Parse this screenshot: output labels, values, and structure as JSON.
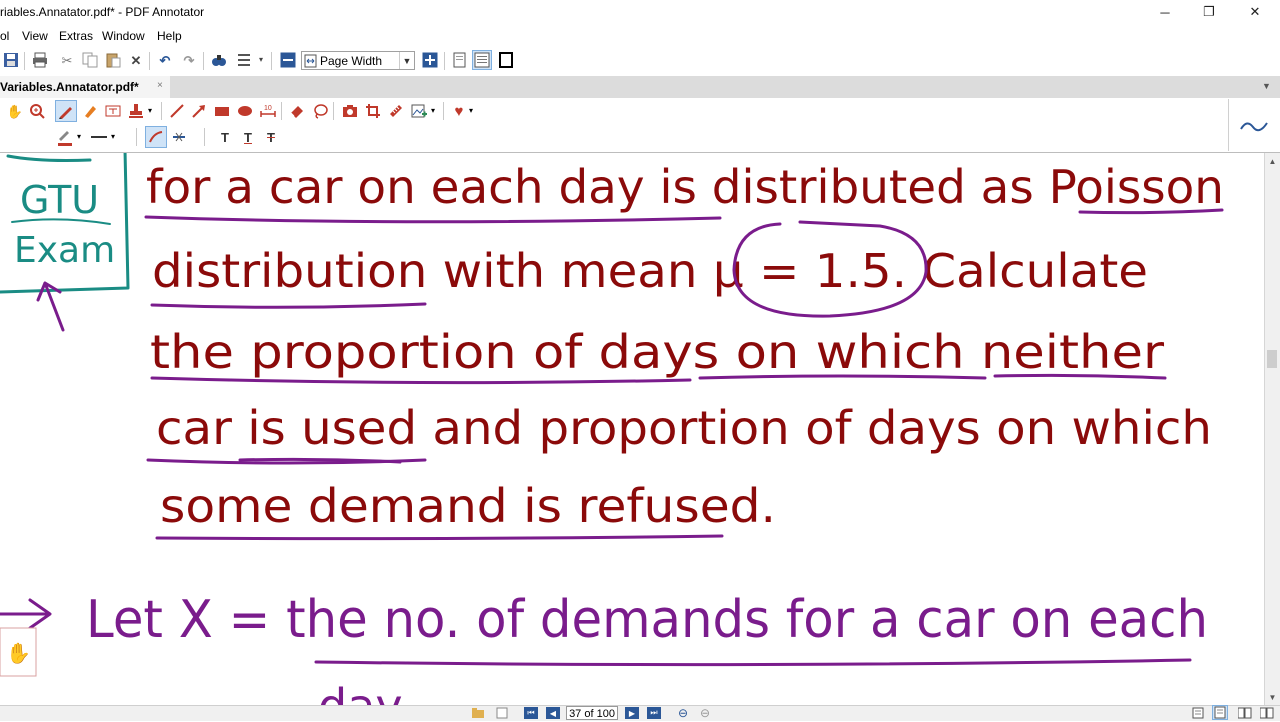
{
  "window": {
    "title": "riables.Annatator.pdf* - PDF Annotator",
    "minimize": "─",
    "restore": "❐",
    "close": "✕"
  },
  "menu": [
    "ol",
    "View",
    "Extras",
    "Window",
    "Help"
  ],
  "toolbar": {
    "zoom_value": "Page Width",
    "icons": [
      "save-icon",
      "print-icon",
      "cut-icon",
      "copy-icon",
      "paste-icon",
      "delete-icon",
      "undo-icon",
      "redo-icon",
      "find-icon",
      "properties-icon",
      "zoom-out-icon",
      "zoom-in-icon",
      "single-page-icon",
      "continuous-page-icon",
      "fullscreen-icon"
    ]
  },
  "tab": {
    "label": "Variables.Annatator.pdf*",
    "close": "×"
  },
  "annotation_tools": {
    "row1": [
      "hand-icon",
      "zoom-tool-icon",
      "pen-icon",
      "highlighter-icon",
      "text-box-icon",
      "stamp-icon",
      "line-icon",
      "arrow-icon",
      "rectangle-icon",
      "ellipse-icon",
      "dimension-icon",
      "eraser-icon",
      "lasso-icon",
      "camera-icon",
      "crop-icon",
      "ruler-icon",
      "image-insert-icon",
      "favorite-heart-icon"
    ],
    "row2": [
      "pen-color-icon",
      "line-width-icon",
      "smooth-stroke-icon",
      "snap-icon",
      "text-insert-icon",
      "text-underline-icon",
      "text-strikeout-icon"
    ]
  },
  "document": {
    "side_note": [
      "GTU",
      "Exam"
    ],
    "lines": [
      "for a car on each day is distributed as Poisson",
      "distribution with mean μ = 1.5. Calculate",
      "the proportion of days on which neither",
      "car is used and proportion of days on which",
      "some demand is refused.",
      "Let X = the no. of demands for a car on each"
    ],
    "next_line_fragment": "day"
  },
  "status": {
    "page": "37 of 100"
  },
  "colors": {
    "ink_red": "#8b0a0a",
    "ink_purple": "#7a1c8c",
    "ink_teal": "#1a8c84",
    "accent_blue": "#2b5797",
    "heart": "#c0392b"
  }
}
